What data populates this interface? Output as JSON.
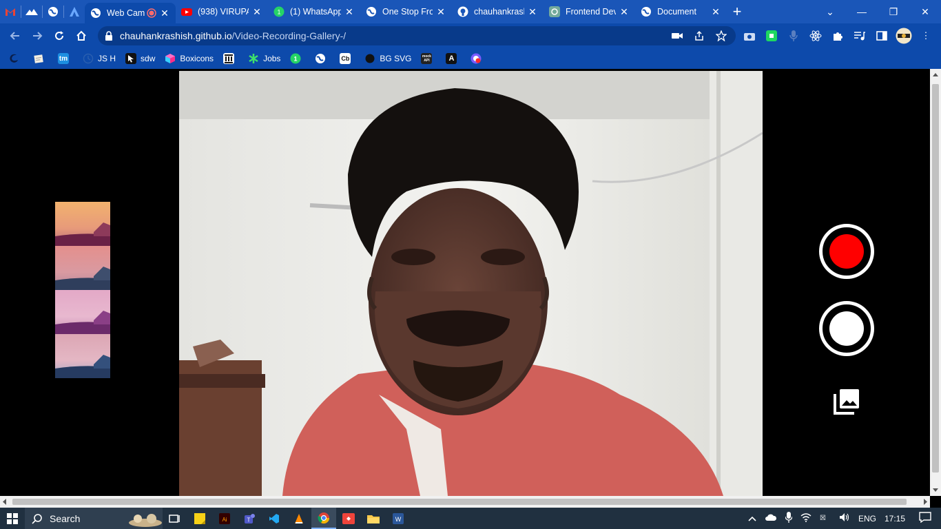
{
  "browser": {
    "tabs": [
      {
        "label": "",
        "icon": "gmail-icon",
        "color": "#ea4335"
      },
      {
        "label": "",
        "icon": "mountain-icon",
        "color": "#ffffff"
      },
      {
        "label": "",
        "icon": "globe-icon",
        "color": "#ffffff"
      },
      {
        "label": "",
        "icon": "a-logo-icon",
        "color": "#6aa8ff"
      },
      {
        "label": "Web Cam",
        "icon": "globe-icon",
        "active": true,
        "recording": true
      },
      {
        "label": "(938) VIRUPA",
        "icon": "youtube-icon",
        "color": "#ff0000"
      },
      {
        "label": "(1) WhatsApp",
        "icon": "whatsapp-icon",
        "color": "#25d366"
      },
      {
        "label": "One Stop Fro",
        "icon": "globe-icon"
      },
      {
        "label": "chauhankrash",
        "icon": "github-icon"
      },
      {
        "label": "Frontend Dev",
        "icon": "chatgpt-icon",
        "color": "#74aa9c"
      },
      {
        "label": "Document",
        "icon": "globe-icon"
      }
    ],
    "new_tab": "+",
    "url_host": "chauhankrashish.github.io",
    "url_path": "/Video-Recording-Gallery-/",
    "bookmarks": [
      {
        "label": "",
        "icon": "edge-icon"
      },
      {
        "label": "",
        "icon": "notes-icon"
      },
      {
        "label": "",
        "icon": "tm-icon",
        "text": "tm"
      },
      {
        "label": "JS H",
        "icon": "history-icon"
      },
      {
        "label": "sdw",
        "icon": "cursor-icon"
      },
      {
        "label": "Boxicons",
        "icon": "boxicons-icon"
      },
      {
        "label": "",
        "icon": "bank-icon"
      },
      {
        "label": "Jobs",
        "icon": "asterisk-icon"
      },
      {
        "label": "",
        "icon": "whatsapp-icon"
      },
      {
        "label": "",
        "icon": "globe-icon"
      },
      {
        "label": "",
        "icon": "cb-icon",
        "text": "Cb"
      },
      {
        "label": "BG SVG",
        "icon": "circle-icon"
      },
      {
        "label": "",
        "icon": "mockapi-icon",
        "text": "mock API"
      },
      {
        "label": "",
        "icon": "angular-icon",
        "text": "A"
      },
      {
        "label": "",
        "icon": "record-ext-icon"
      }
    ]
  },
  "app": {
    "record_button_color": "#ff0000",
    "capture_button_color": "#ffffff",
    "gallery_icon": "photo-library-icon"
  },
  "taskbar": {
    "search_label": "Search",
    "language": "ENG",
    "time": "17:15"
  }
}
